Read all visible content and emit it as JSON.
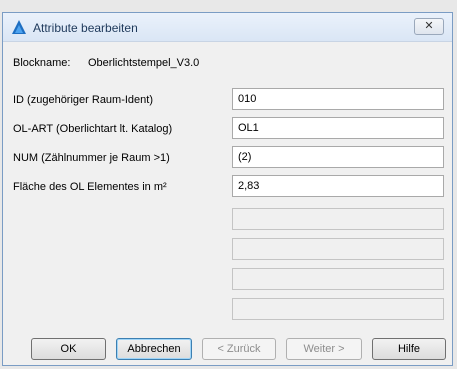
{
  "window": {
    "title": "Attribute bearbeiten",
    "close_glyph": "✕",
    "title_icon": "triangle-app-icon",
    "accent": "#1e6fc2"
  },
  "block": {
    "label": "Blockname:",
    "value": "Oberlichtstempel_V3.0"
  },
  "attributes": [
    {
      "label": "ID (zugehöriger Raum-Ident)",
      "value": "010"
    },
    {
      "label": "OL-ART (Oberlichtart lt. Katalog)",
      "value": "OL1"
    },
    {
      "label": "NUM (Zählnummer je Raum >1)",
      "value": "(2)"
    },
    {
      "label": "Fläche des OL Elementes in m²",
      "value": "2,83"
    }
  ],
  "empty_fields": 4,
  "buttons": {
    "ok": "OK",
    "cancel": "Abbrechen",
    "back": "< Zurück",
    "next": "Weiter >",
    "help": "Hilfe"
  }
}
